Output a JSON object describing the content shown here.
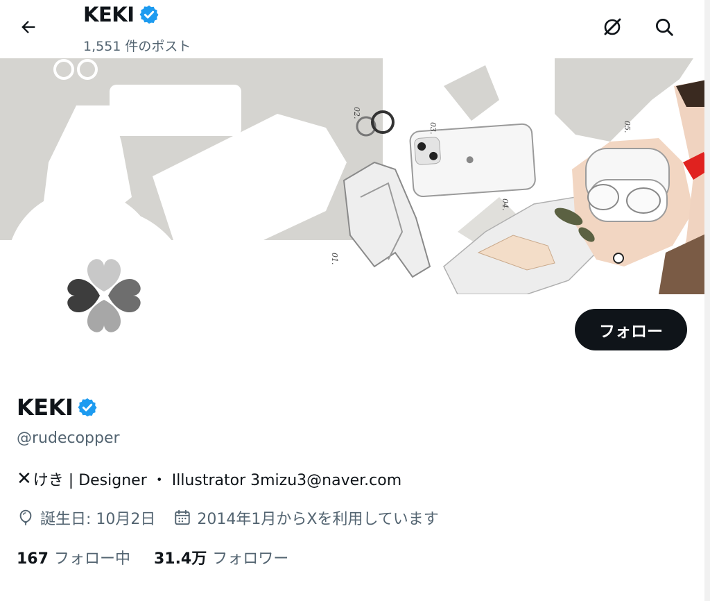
{
  "header": {
    "title": "KEKI",
    "post_count": "1,551 件のポスト",
    "back_icon": "arrow-left-icon",
    "icons": [
      "grok-icon",
      "search-icon"
    ]
  },
  "profile": {
    "name": "KEKI",
    "handle": "@rudecopper",
    "bio_prefix": "✕",
    "bio": "けき | Designer ・ Illustrator 3mizu3@naver.com",
    "birthday": "誕生日: 10月2日",
    "joined": "2014年1月からXを利用しています",
    "follow_label": "フォロー",
    "following_count": "167",
    "following_label": "フォロー中",
    "followers_count": "31.4万",
    "followers_label": "フォロワー"
  },
  "banner": {
    "labels": [
      "01.",
      "02.",
      "03.",
      "04.",
      "05."
    ]
  },
  "colors": {
    "accent": "#1d9bf0",
    "text": "#0f1419",
    "muted": "#536471",
    "button": "#0f1419"
  }
}
